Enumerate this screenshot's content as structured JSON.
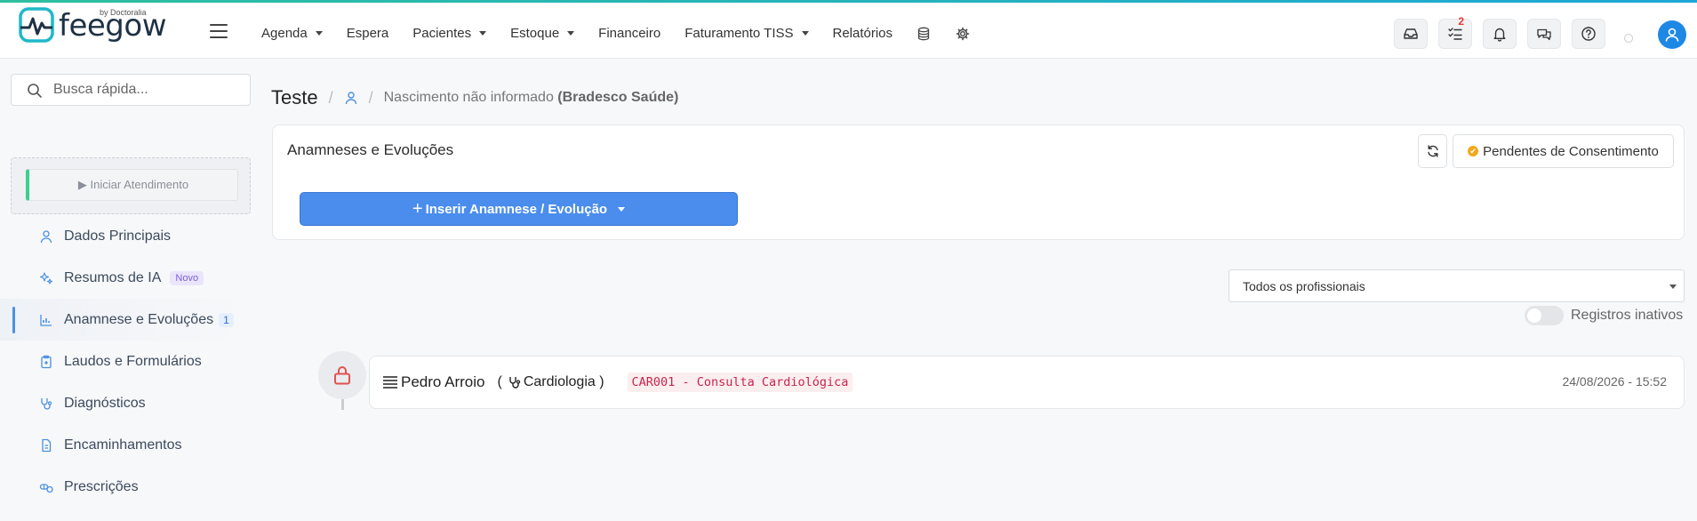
{
  "brand": {
    "name": "feegow",
    "sub": "by Doctoralia"
  },
  "nav": [
    {
      "label": "Agenda",
      "dropdown": true
    },
    {
      "label": "Espera",
      "dropdown": false
    },
    {
      "label": "Pacientes",
      "dropdown": true
    },
    {
      "label": "Estoque",
      "dropdown": true
    },
    {
      "label": "Financeiro",
      "dropdown": false
    },
    {
      "label": "Faturamento TISS",
      "dropdown": true
    },
    {
      "label": "Relatórios",
      "dropdown": false
    }
  ],
  "top_actions": {
    "tasks_badge": "2"
  },
  "sidebar": {
    "search_placeholder": "Busca rápida...",
    "start_label": "▶ Iniciar Atendimento",
    "items": [
      {
        "label": "Dados Principais",
        "icon": "user-icon"
      },
      {
        "label": "Resumos de IA",
        "icon": "sparkles-icon",
        "tag": "Novo"
      },
      {
        "label": "Anamnese e Evoluções",
        "icon": "chart-icon",
        "count": "1",
        "active": true
      },
      {
        "label": "Laudos e Formulários",
        "icon": "clipboard-icon"
      },
      {
        "label": "Diagnósticos",
        "icon": "stethoscope-icon"
      },
      {
        "label": "Encaminhamentos",
        "icon": "file-icon"
      },
      {
        "label": "Prescrições",
        "icon": "pills-icon"
      }
    ]
  },
  "breadcrumb": {
    "title": "Teste",
    "birth": "Nascimento não informado",
    "insurance": "(Bradesco Saúde)"
  },
  "card": {
    "title": "Anamneses e Evoluções",
    "consent_label": "Pendentes de Consentimento",
    "insert_label": "Inserir Anamnese / Evolução"
  },
  "filter": {
    "selected": "Todos os profissionais"
  },
  "inactive_toggle": {
    "label": "Registros inativos"
  },
  "record": {
    "professional": "Pedro Arroio",
    "specialty": "Cardiologia",
    "code": "CAR001 - Consulta Cardiológica",
    "datetime": "24/08/2026 - 15:52"
  },
  "colors": {
    "primary": "#4a8ded",
    "accent_green": "#3ccf8e",
    "lock_red": "#e05252",
    "avatar_blue": "#1e88e5"
  }
}
